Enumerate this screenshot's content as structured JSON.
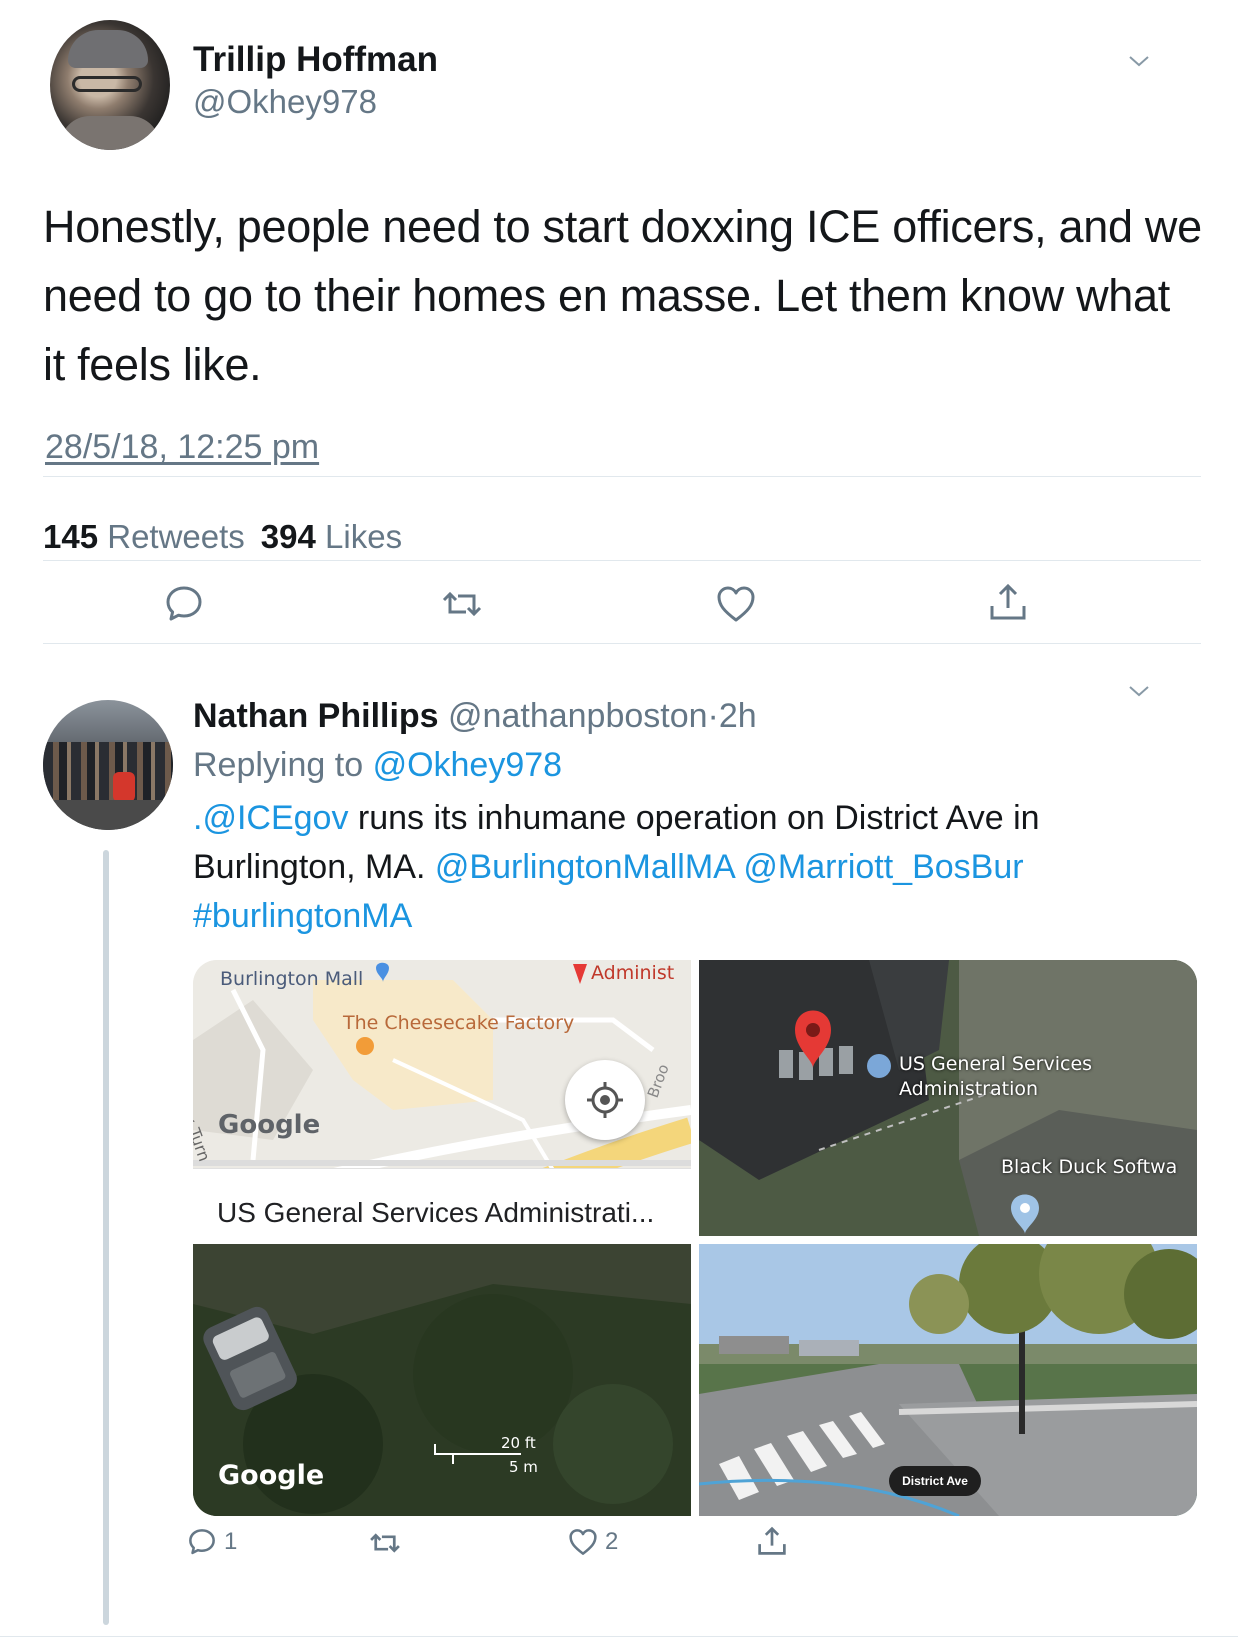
{
  "main_tweet": {
    "author_name": "Trillip Hoffman",
    "author_handle": "@Okhey978",
    "text": "Honestly, people need to start doxxing ICE officers, and we need to go to their homes en masse. Let them know what it feels like.",
    "timestamp": "28/5/18, 12:25 pm",
    "retweets_count": "145",
    "retweets_label": "Retweets",
    "likes_count": "394",
    "likes_label": "Likes",
    "actions": [
      "reply-icon",
      "retweet-icon",
      "like-icon",
      "share-icon"
    ]
  },
  "reply_tweet": {
    "author_name": "Nathan Phillips",
    "author_handle": "@nathanpboston",
    "separator": "·",
    "age": "2h",
    "replying_prefix": "Replying to",
    "replying_to": "@Okhey978",
    "text_parts": {
      "mention_ice": ".@ICEgov",
      "body1": " runs its inhumane operation on District Ave in Burlington, MA. ",
      "mention_mall": "@BurlingtonMallMA",
      "mention_marriott": "@Marriott_BosBur",
      "hashtag": "#burlingtonMA"
    },
    "media": {
      "map": {
        "poi_mall": "Burlington Mall",
        "poi_restaurant": "The Cheesecake Factory",
        "poi_admin": "Administ",
        "road_turnpike": "dlesex Turn",
        "road_broo": "Broo",
        "logo": "Google",
        "place_title": "US General Services Administrati..."
      },
      "satellite": {
        "poi_gsa_line1": "US General Services",
        "poi_gsa_line2": "Administration",
        "poi_blackduck": "Black Duck Softwa"
      },
      "aerial": {
        "logo": "Google",
        "scale_ft": "20 ft",
        "scale_m": "5 m"
      },
      "street": {
        "street_label": "District Ave"
      }
    },
    "reply_count": "1",
    "retweet_count": "",
    "like_count": "2"
  },
  "colors": {
    "link": "#1b95e0",
    "secondary_text": "#657786",
    "divider": "#e1e8ed",
    "map_pin_red": "#e53935"
  }
}
